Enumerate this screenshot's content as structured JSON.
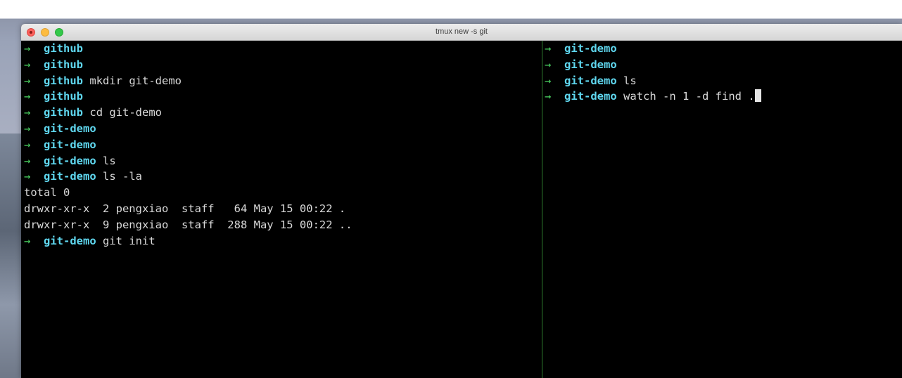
{
  "window": {
    "title": "tmux new -s git"
  },
  "left_pane": {
    "lines": [
      {
        "type": "prompt",
        "arrow": "→",
        "dir": "github",
        "cmd": ""
      },
      {
        "type": "prompt",
        "arrow": "→",
        "dir": "github",
        "cmd": ""
      },
      {
        "type": "prompt",
        "arrow": "→",
        "dir": "github",
        "cmd": "mkdir git-demo"
      },
      {
        "type": "prompt",
        "arrow": "→",
        "dir": "github",
        "cmd": ""
      },
      {
        "type": "prompt",
        "arrow": "→",
        "dir": "github",
        "cmd": "cd git-demo"
      },
      {
        "type": "prompt",
        "arrow": "→",
        "dir": "git-demo",
        "cmd": ""
      },
      {
        "type": "prompt",
        "arrow": "→",
        "dir": "git-demo",
        "cmd": ""
      },
      {
        "type": "prompt",
        "arrow": "→",
        "dir": "git-demo",
        "cmd": "ls"
      },
      {
        "type": "prompt",
        "arrow": "→",
        "dir": "git-demo",
        "cmd": "ls -la"
      },
      {
        "type": "output",
        "text": "total 0"
      },
      {
        "type": "output",
        "text": "drwxr-xr-x  2 pengxiao  staff   64 May 15 00:22 ."
      },
      {
        "type": "output",
        "text": "drwxr-xr-x  9 pengxiao  staff  288 May 15 00:22 .."
      },
      {
        "type": "prompt",
        "arrow": "→",
        "dir": "git-demo",
        "cmd": "git init"
      }
    ]
  },
  "right_pane": {
    "lines": [
      {
        "type": "prompt",
        "arrow": "→",
        "dir": "git-demo",
        "cmd": ""
      },
      {
        "type": "prompt",
        "arrow": "→",
        "dir": "git-demo",
        "cmd": ""
      },
      {
        "type": "prompt",
        "arrow": "→",
        "dir": "git-demo",
        "cmd": "ls"
      },
      {
        "type": "prompt",
        "arrow": "→",
        "dir": "git-demo",
        "cmd": "watch -n 1 -d find .",
        "cursor": true
      }
    ]
  },
  "colors": {
    "arrow": "#4cd964",
    "directory": "#5fd7ef",
    "text": "#d9d9d9",
    "background": "#000000",
    "pane_divider": "#2f7d2f"
  }
}
